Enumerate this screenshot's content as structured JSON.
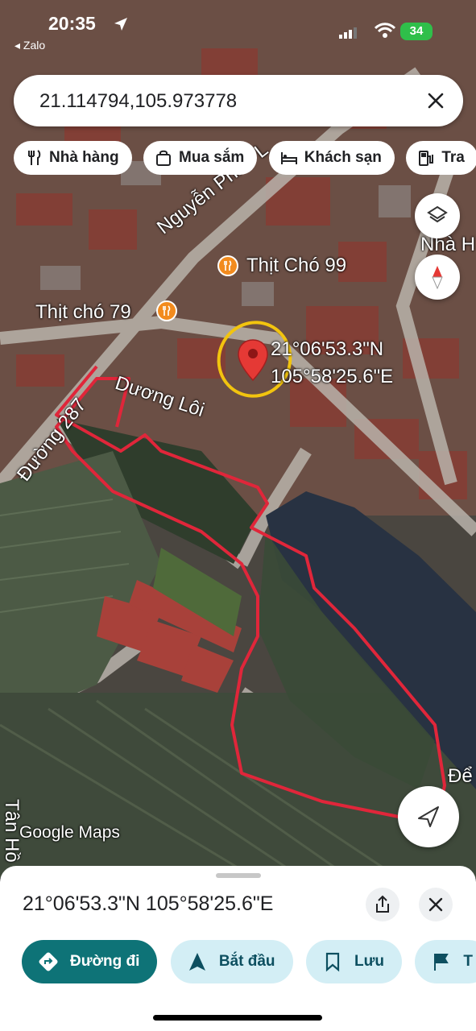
{
  "status_bar": {
    "time": "20:35",
    "back_app": "◂ Zalo",
    "battery": "34"
  },
  "search": {
    "query": "21.114794,105.973778"
  },
  "chips": [
    {
      "label": "Nhà hàng",
      "icon": "restaurant-icon"
    },
    {
      "label": "Mua sắm",
      "icon": "shopping-bag-icon"
    },
    {
      "label": "Khách sạn",
      "icon": "hotel-bed-icon"
    },
    {
      "label": "Tra",
      "icon": "gas-station-icon"
    }
  ],
  "map": {
    "labels": {
      "road_nguyen_phi": "Nguyễn Phi Ỷ L",
      "poi_1": "Thịt Chó 99",
      "poi_2": "Thịt chó 79",
      "coord_lat": "21°06'53.3\"N",
      "coord_lng": "105°58'25.6\"E",
      "road_duong_loi": "Dương Lôi",
      "road_287": "Đường 287",
      "road_tan": "Tân Hồ",
      "edge_nha": "Nhà H",
      "edge_de": "Để",
      "watermark": "Google Maps"
    }
  },
  "sheet": {
    "title": "21°06'53.3\"N 105°58'25.6\"E",
    "actions": [
      {
        "label": "Đường đi",
        "icon": "directions-icon",
        "style": "primary"
      },
      {
        "label": "Bắt đầu",
        "icon": "navigation-arrow-icon",
        "style": "secondary"
      },
      {
        "label": "Lưu",
        "icon": "bookmark-icon",
        "style": "secondary"
      },
      {
        "label": "T",
        "icon": "flag-icon",
        "style": "secondary"
      }
    ]
  },
  "colors": {
    "primary": "#0e7377",
    "secondary": "#d3eef5",
    "route": "#e0263a",
    "circle": "#f2c40f"
  }
}
